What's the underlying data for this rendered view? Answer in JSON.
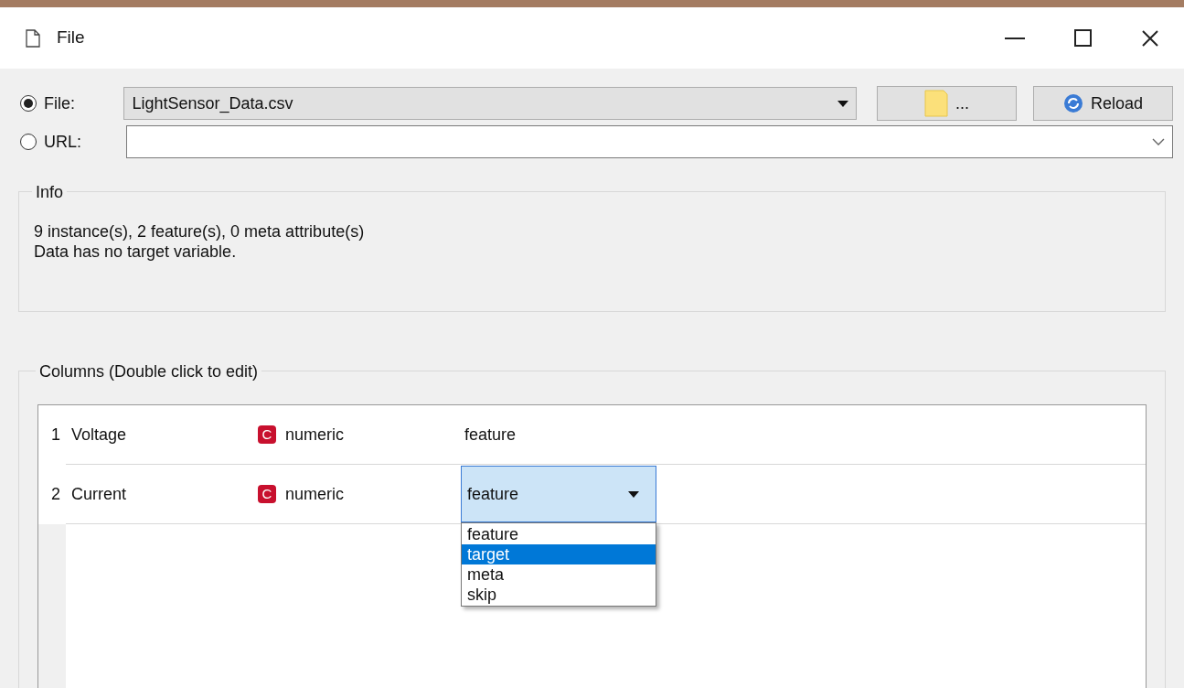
{
  "window": {
    "title": "File"
  },
  "source": [
    {
      "label": "File:",
      "selected": true,
      "kind": "combo",
      "value": "LightSensor_Data.csv"
    },
    {
      "label": "URL:",
      "selected": false,
      "kind": "editable"
    }
  ],
  "buttons": [
    {
      "label": "...",
      "kind": "browse"
    },
    {
      "label": "Reload",
      "kind": "reload"
    }
  ],
  "info": {
    "title": "Info",
    "lines": [
      "9 instance(s), 2 feature(s), 0 meta attribute(s)",
      "Data has no target variable."
    ]
  },
  "columns": {
    "title": "Columns (Double click to edit)",
    "rows": [
      {
        "index": "1",
        "name": "Voltage",
        "badge": "C",
        "type": "numeric",
        "role": "feature",
        "editing": false
      },
      {
        "index": "2",
        "name": "Current",
        "badge": "C",
        "type": "numeric",
        "role": "feature",
        "editing": true
      }
    ],
    "role_options": [
      {
        "label": "feature",
        "selected": false
      },
      {
        "label": "target",
        "selected": true
      },
      {
        "label": "meta",
        "selected": false
      },
      {
        "label": "skip",
        "selected": false
      }
    ]
  }
}
